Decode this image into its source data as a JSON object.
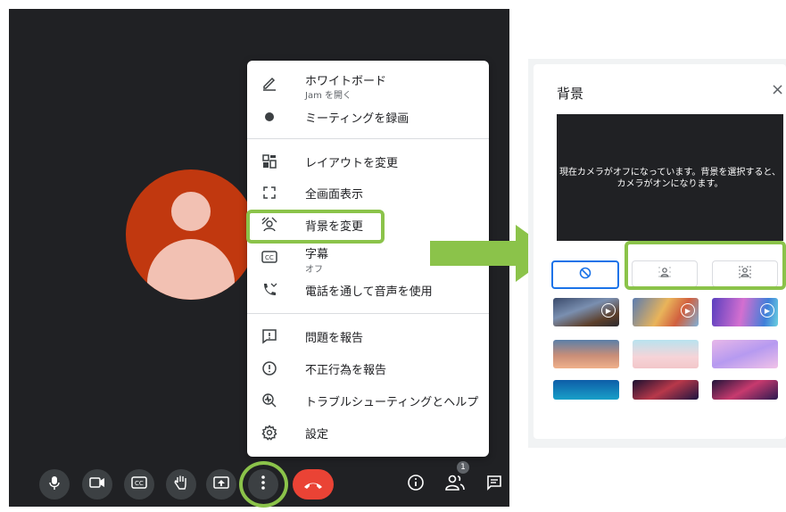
{
  "menu": {
    "items": [
      {
        "label": "ホワイトボード",
        "sub": "Jam を開く",
        "icon": "pencil-icon"
      },
      {
        "label": "ミーティングを録画",
        "icon": "record-icon"
      },
      {
        "label": "レイアウトを変更",
        "icon": "layout-icon"
      },
      {
        "label": "全画面表示",
        "icon": "fullscreen-icon"
      },
      {
        "label": "背景を変更",
        "icon": "background-icon"
      },
      {
        "label": "字幕",
        "sub": "オフ",
        "icon": "captions-icon"
      },
      {
        "label": "電話を通して音声を使用",
        "icon": "phone-icon"
      },
      {
        "label": "問題を報告",
        "icon": "report-issue-icon"
      },
      {
        "label": "不正行為を報告",
        "icon": "abuse-icon"
      },
      {
        "label": "トラブルシューティングとヘルプ",
        "icon": "troubleshoot-icon"
      },
      {
        "label": "設定",
        "icon": "settings-icon"
      }
    ]
  },
  "toolbar": {
    "icons": [
      "mic-icon",
      "camera-icon",
      "captions-icon",
      "raise-hand-icon",
      "present-icon",
      "more-options-icon",
      "end-call-icon",
      "info-icon",
      "people-icon",
      "chat-icon"
    ],
    "participant_count": "1"
  },
  "background_panel": {
    "title": "背景",
    "close": "×",
    "preview_text": "現在カメラがオフになっています。背景を選択すると、カメラがオンになります。",
    "options": [
      "no-effect",
      "slight-blur",
      "blur"
    ],
    "thumbnails": [
      "clouds-video",
      "party-video",
      "beach-video",
      "sunset",
      "pink-beach",
      "purple-sky",
      "underwater",
      "nebula",
      "galaxy"
    ]
  },
  "colors": {
    "highlight": "#8bc34a",
    "end_call": "#ea4335",
    "accent": "#1a73e8",
    "avatar": "#c1380f"
  }
}
